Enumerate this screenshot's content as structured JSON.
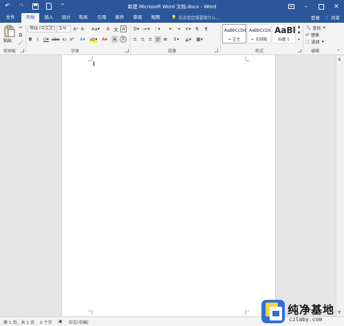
{
  "titlebar": {
    "title": "新建 Microsoft Word 文档.docx - Word",
    "qat_icons": [
      "undo-icon",
      "redo-icon",
      "save-icon",
      "new-doc-icon",
      "customize-icon"
    ]
  },
  "tabs": [
    {
      "label": "文件",
      "active": false
    },
    {
      "label": "开始",
      "active": true
    },
    {
      "label": "插入",
      "active": false
    },
    {
      "label": "设计",
      "active": false
    },
    {
      "label": "布局",
      "active": false
    },
    {
      "label": "引用",
      "active": false
    },
    {
      "label": "邮件",
      "active": false
    },
    {
      "label": "审阅",
      "active": false
    },
    {
      "label": "视图",
      "active": false
    }
  ],
  "tellme": {
    "text": "告诉我您想要做什么..."
  },
  "account": {
    "signin": "登录",
    "share": "共享"
  },
  "ribbon": {
    "clipboard": {
      "paste_label": "粘贴",
      "group_label": "剪贴板"
    },
    "font": {
      "font_name": "等线 (中文正文)",
      "font_size": "五号",
      "group_label": "字体"
    },
    "paragraph": {
      "group_label": "段落"
    },
    "styles": {
      "group_label": "样式",
      "items": [
        {
          "sample": "AaBbCcDd",
          "name": "↵ 正文"
        },
        {
          "sample": "AaBbCcDd",
          "name": "↵ 无间隔"
        },
        {
          "sample": "AaBl",
          "name": "标题 1"
        }
      ]
    },
    "editing": {
      "group_label": "编辑",
      "find": "查找",
      "replace": "替换",
      "select": "选择"
    }
  },
  "statusbar": {
    "page": "第 1 页，共 1 页",
    "words": "0 个字",
    "language": "中文(中国)"
  },
  "watermark": {
    "text": "纯净基地",
    "url": "czlaby.com"
  },
  "colors": {
    "accent": "#2b579a",
    "ribbon_bg": "#f3f3f3",
    "doc_bg": "#e6e6e6"
  }
}
